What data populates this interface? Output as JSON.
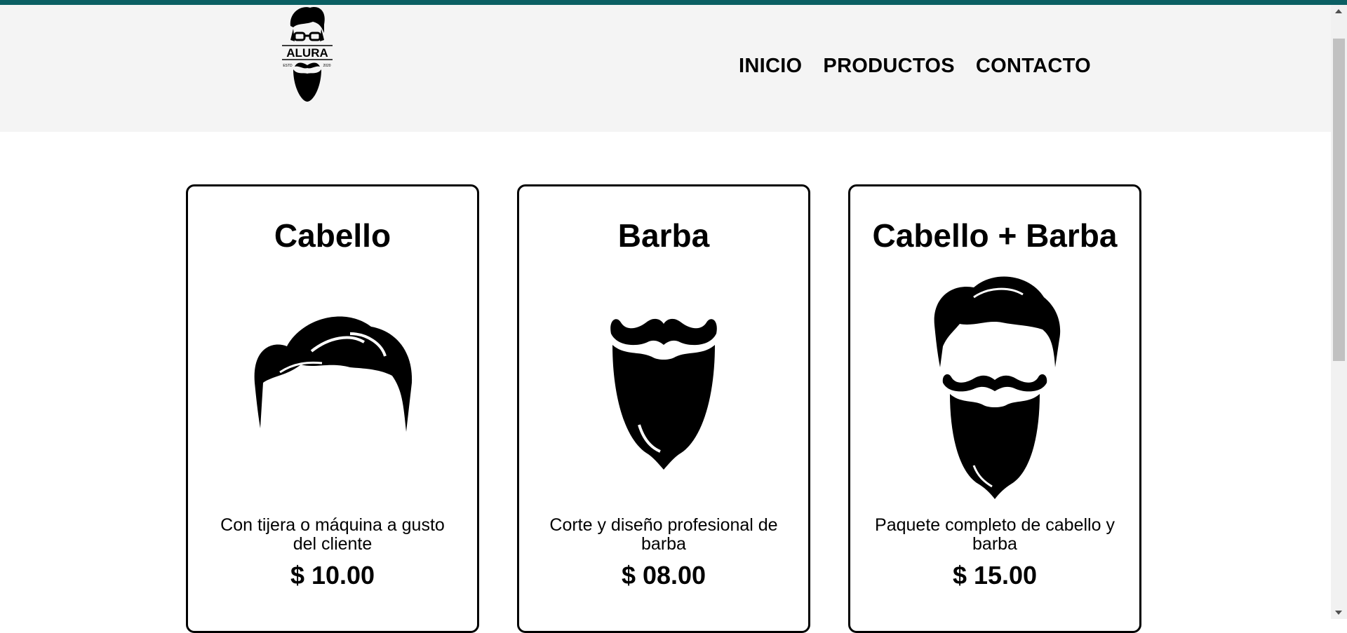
{
  "brand": {
    "name": "ALURA",
    "est_left": "ESTD",
    "est_right": "2020"
  },
  "nav": {
    "items": [
      {
        "label": "INICIO"
      },
      {
        "label": "PRODUCTOS"
      },
      {
        "label": "CONTACTO"
      }
    ]
  },
  "products": [
    {
      "title": "Cabello",
      "icon": "hair-icon",
      "description": "Con tijera o máquina a gusto del cliente",
      "price": "$ 10.00"
    },
    {
      "title": "Barba",
      "icon": "beard-icon",
      "description": "Corte y diseño profesional de barba",
      "price": "$ 08.00"
    },
    {
      "title": "Cabello + Barba",
      "icon": "hair-and-beard-icon",
      "description": "Paquete completo de cabello y barba",
      "price": "$ 15.00"
    }
  ],
  "colors": {
    "accent_bar": "#0b5f63",
    "header_bg": "#f4f4f4",
    "card_border": "#000000"
  }
}
